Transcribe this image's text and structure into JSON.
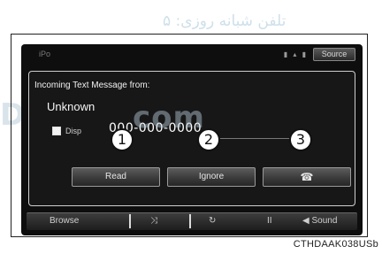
{
  "watermark": {
    "persian": "تلفن شبانه روزی: ۵",
    "latin_left": "DS",
    "latin_mid": "com"
  },
  "status_bar": {
    "app_label": "iPo",
    "icons_text": "▮ ▴ ▮",
    "source_button": "Source"
  },
  "dialog": {
    "title": "Incoming Text Message from:",
    "sender": "Unknown",
    "checkbox_label": "Disp",
    "phone_number": "000-000-0000"
  },
  "callouts": [
    "1",
    "2",
    "3"
  ],
  "actions": {
    "read": "Read",
    "ignore": "Ignore",
    "call_icon": "phone-icon",
    "call_glyph": "☎"
  },
  "bottom_bar": {
    "browse": "Browse",
    "shuffle_glyph": "⤨",
    "repeat_glyph": "↻",
    "pause_glyph": "II",
    "sound": "◀ Sound"
  },
  "caption": "CTHDAAK038USb"
}
